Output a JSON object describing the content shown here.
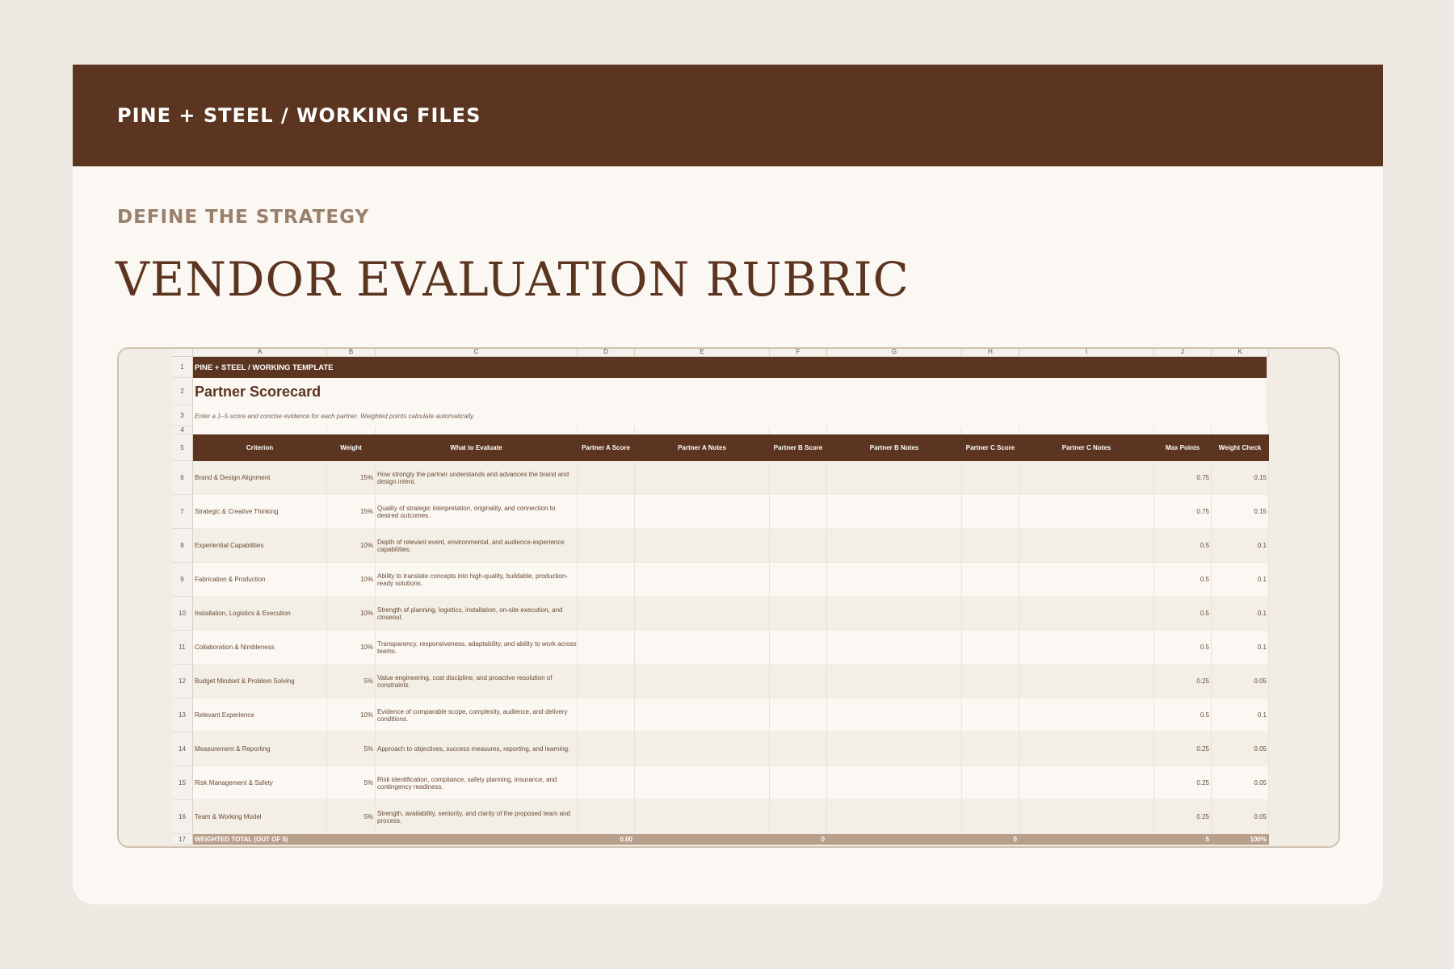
{
  "header": {
    "brand": "PINE + STEEL / WORKING FILES"
  },
  "eyebrow": "DEFINE THE STRATEGY",
  "title": "VENDOR EVALUATION RUBRIC",
  "sheet": {
    "columns": [
      "A",
      "B",
      "C",
      "D",
      "E",
      "F",
      "G",
      "H",
      "I",
      "J",
      "K"
    ],
    "row_numbers": [
      "1",
      "2",
      "3",
      "4",
      "5",
      "6",
      "7",
      "8",
      "9",
      "10",
      "11",
      "12",
      "13",
      "14",
      "15",
      "16",
      "17"
    ],
    "banner": "PINE + STEEL / WORKING TEMPLATE",
    "heading": "Partner Scorecard",
    "instructions": "Enter a 1–5 score and concise evidence for each partner. Weighted points calculate automatically.",
    "headers": [
      "Criterion",
      "Weight",
      "What to Evaluate",
      "Partner A Score",
      "Partner A Notes",
      "Partner B Score",
      "Partner B Notes",
      "Partner C Score",
      "Partner C Notes",
      "Max Points",
      "Weight Check"
    ],
    "rows": [
      {
        "criterion": "Brand & Design Alignment",
        "weight": "15%",
        "evaluate": "How strongly the partner understands and advances the brand and design intent.",
        "max": "0.75",
        "check": "0.15"
      },
      {
        "criterion": "Strategic & Creative Thinking",
        "weight": "15%",
        "evaluate": "Quality of strategic interpretation, originality, and connection to desired outcomes.",
        "max": "0.75",
        "check": "0.15"
      },
      {
        "criterion": "Experiential Capabilities",
        "weight": "10%",
        "evaluate": "Depth of relevant event, environmental, and audience-experience capabilities.",
        "max": "0.5",
        "check": "0.1"
      },
      {
        "criterion": "Fabrication & Production",
        "weight": "10%",
        "evaluate": "Ability to translate concepts into high-quality, buildable, production-ready solutions.",
        "max": "0.5",
        "check": "0.1"
      },
      {
        "criterion": "Installation, Logistics & Execution",
        "weight": "10%",
        "evaluate": "Strength of planning, logistics, installation, on-site execution, and closeout.",
        "max": "0.5",
        "check": "0.1"
      },
      {
        "criterion": "Collaboration & Nimbleness",
        "weight": "10%",
        "evaluate": "Transparency, responsiveness, adaptability, and ability to work across teams.",
        "max": "0.5",
        "check": "0.1"
      },
      {
        "criterion": "Budget Mindset & Problem Solving",
        "weight": "5%",
        "evaluate": "Value engineering, cost discipline, and proactive resolution of constraints.",
        "max": "0.25",
        "check": "0.05"
      },
      {
        "criterion": "Relevant Experience",
        "weight": "10%",
        "evaluate": "Evidence of comparable scope, complexity, audience, and delivery conditions.",
        "max": "0.5",
        "check": "0.1"
      },
      {
        "criterion": "Measurement & Reporting",
        "weight": "5%",
        "evaluate": "Approach to objectives, success measures, reporting, and learning.",
        "max": "0.25",
        "check": "0.05"
      },
      {
        "criterion": "Risk Management & Safety",
        "weight": "5%",
        "evaluate": "Risk identification, compliance, safety planning, insurance, and contingency readiness.",
        "max": "0.25",
        "check": "0.05"
      },
      {
        "criterion": "Team & Working Model",
        "weight": "5%",
        "evaluate": "Strength, availability, seniority, and clarity of the proposed team and process.",
        "max": "0.25",
        "check": "0.05"
      }
    ],
    "total": {
      "label": "WEIGHTED TOTAL (OUT OF 5)",
      "partner_a": "0.00",
      "partner_b": "0",
      "partner_c": "0",
      "max": "5",
      "check": "100%"
    }
  }
}
